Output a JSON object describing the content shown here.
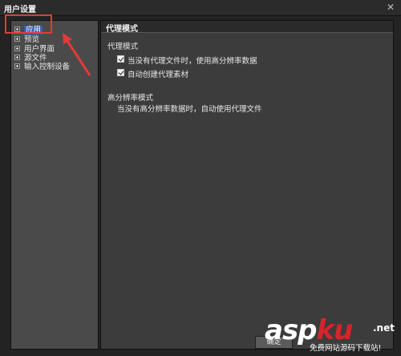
{
  "window": {
    "title": "用户设置"
  },
  "sidebar": {
    "items": [
      {
        "label": "应用",
        "selected": true
      },
      {
        "label": "预览"
      },
      {
        "label": "用户界面"
      },
      {
        "label": "源文件"
      },
      {
        "label": "输入控制设备"
      }
    ]
  },
  "panel": {
    "header": "代理模式",
    "section1": {
      "title": "代理模式",
      "options": [
        {
          "label": "当没有代理文件时，使用高分辨率数据",
          "checked": true
        },
        {
          "label": "自动创建代理素材",
          "checked": true
        }
      ]
    },
    "section2": {
      "title": "高分辨率模式",
      "description": "当没有高分辨率数据时，自动使用代理文件"
    }
  },
  "footer": {
    "ok_label": "确定"
  },
  "watermark": {
    "main_a": "asp",
    "main_b": "ku",
    "net": ".net",
    "sub": "免费网站源码下载站!"
  },
  "colors": {
    "annotation": "#e23a3a",
    "selection": "#3a5fb3"
  }
}
